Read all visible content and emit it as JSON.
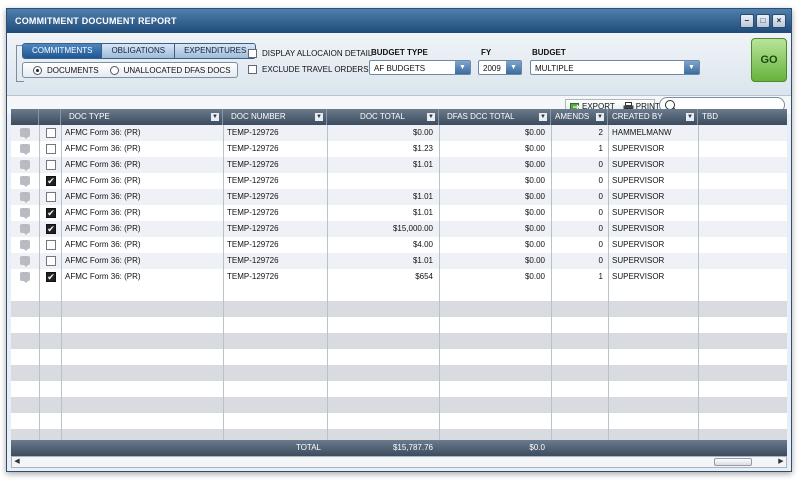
{
  "window": {
    "title": "COMMITMENT DOCUMENT REPORT",
    "controls": [
      "–",
      "□",
      "×"
    ]
  },
  "filters": {
    "tabs": [
      "COMMITMENTS",
      "OBLIGATIONS",
      "EXPENDITURES"
    ],
    "active_tab": 0,
    "radio": {
      "documents": "DOCUMENTS",
      "unallocated": "UNALLOCATED DFAS DOCS",
      "selected": "documents"
    },
    "checkboxes": {
      "display_alloc": "DISPLAY ALLOCAION DETAIL",
      "exclude_travel": "EXCLUDE TRAVEL ORDERS"
    },
    "budget_type": {
      "label": "BUDGET TYPE",
      "value": "AF BUDGETS"
    },
    "fy": {
      "label": "FY",
      "value": "2009"
    },
    "budget": {
      "label": "BUDGET",
      "value": "MULTIPLE"
    },
    "go": "GO"
  },
  "toolbar": {
    "export": "EXPORT",
    "print": "PRINT",
    "search_placeholder": ""
  },
  "table": {
    "headers": [
      "DOC TYPE",
      "DOC NUMBER",
      "DOC TOTAL",
      "DFAS DCC TOTAL",
      "AMENDS",
      "CREATED BY",
      "TBD"
    ],
    "rows": [
      {
        "checked": false,
        "doc_type": "AFMC Form 36: (PR)",
        "doc_number": "TEMP-129726",
        "doc_total": "$0.00",
        "dfas_total": "$0.00",
        "amends": "2",
        "created_by": "HAMMELMANW"
      },
      {
        "checked": false,
        "doc_type": "AFMC Form 36: (PR)",
        "doc_number": "TEMP-129726",
        "doc_total": "$1.23",
        "dfas_total": "$0.00",
        "amends": "1",
        "created_by": "SUPERVISOR"
      },
      {
        "checked": false,
        "doc_type": "AFMC Form 36: (PR)",
        "doc_number": "TEMP-129726",
        "doc_total": "$1.01",
        "dfas_total": "$0.00",
        "amends": "0",
        "created_by": "SUPERVISOR"
      },
      {
        "checked": true,
        "doc_type": "AFMC Form 36: (PR)",
        "doc_number": "TEMP-129726",
        "doc_total": "",
        "dfas_total": "$0.00",
        "amends": "0",
        "created_by": "SUPERVISOR"
      },
      {
        "checked": false,
        "doc_type": "AFMC Form 36: (PR)",
        "doc_number": "TEMP-129726",
        "doc_total": "$1.01",
        "dfas_total": "$0.00",
        "amends": "0",
        "created_by": "SUPERVISOR"
      },
      {
        "checked": true,
        "doc_type": "AFMC Form 36: (PR)",
        "doc_number": "TEMP-129726",
        "doc_total": "$1.01",
        "dfas_total": "$0.00",
        "amends": "0",
        "created_by": "SUPERVISOR"
      },
      {
        "checked": true,
        "doc_type": "AFMC Form 36: (PR)",
        "doc_number": "TEMP-129726",
        "doc_total": "$15,000.00",
        "dfas_total": "$0.00",
        "amends": "0",
        "created_by": "SUPERVISOR"
      },
      {
        "checked": false,
        "doc_type": "AFMC Form 36: (PR)",
        "doc_number": "TEMP-129726",
        "doc_total": "$4.00",
        "dfas_total": "$0.00",
        "amends": "0",
        "created_by": "SUPERVISOR"
      },
      {
        "checked": false,
        "doc_type": "AFMC Form 36: (PR)",
        "doc_number": "TEMP-129726",
        "doc_total": "$1.01",
        "dfas_total": "$0.00",
        "amends": "0",
        "created_by": "SUPERVISOR"
      },
      {
        "checked": true,
        "doc_type": "AFMC Form 36: (PR)",
        "doc_number": "TEMP-129726",
        "doc_total": "$654",
        "dfas_total": "$0.00",
        "amends": "1",
        "created_by": "SUPERVISOR"
      }
    ],
    "footer": {
      "label": "TOTAL",
      "doc_total": "$15,787.76",
      "dfas_total": "$0.0"
    }
  }
}
